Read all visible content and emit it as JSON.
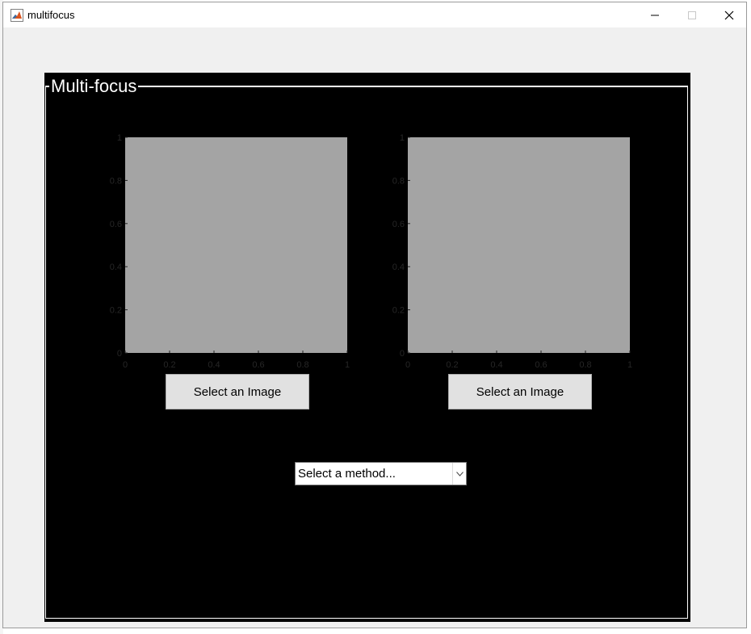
{
  "window": {
    "title": "multifocus"
  },
  "panel": {
    "title": "Multi-focus"
  },
  "axes": [
    {
      "xticks": [
        "0",
        "0.2",
        "0.4",
        "0.6",
        "0.8",
        "1"
      ],
      "yticks": [
        "0",
        "0.2",
        "0.4",
        "0.6",
        "0.8",
        "1"
      ],
      "xlim": [
        0,
        1
      ],
      "ylim": [
        0,
        1
      ],
      "plot_color": "#a4a4a4",
      "tick_color": "#262626"
    },
    {
      "xticks": [
        "0",
        "0.2",
        "0.4",
        "0.6",
        "0.8",
        "1"
      ],
      "yticks": [
        "0",
        "0.2",
        "0.4",
        "0.6",
        "0.8",
        "1"
      ],
      "xlim": [
        0,
        1
      ],
      "ylim": [
        0,
        1
      ],
      "plot_color": "#a4a4a4",
      "tick_color": "#262626"
    }
  ],
  "buttons": {
    "select_image_1": "Select an Image",
    "select_image_2": "Select an Image"
  },
  "method_select": {
    "selected": "Select a method..."
  },
  "colors": {
    "panel_background": "#000000",
    "panel_border": "#ffffff",
    "window_background": "#f0f0f0",
    "button_background": "#e1e1e1"
  }
}
